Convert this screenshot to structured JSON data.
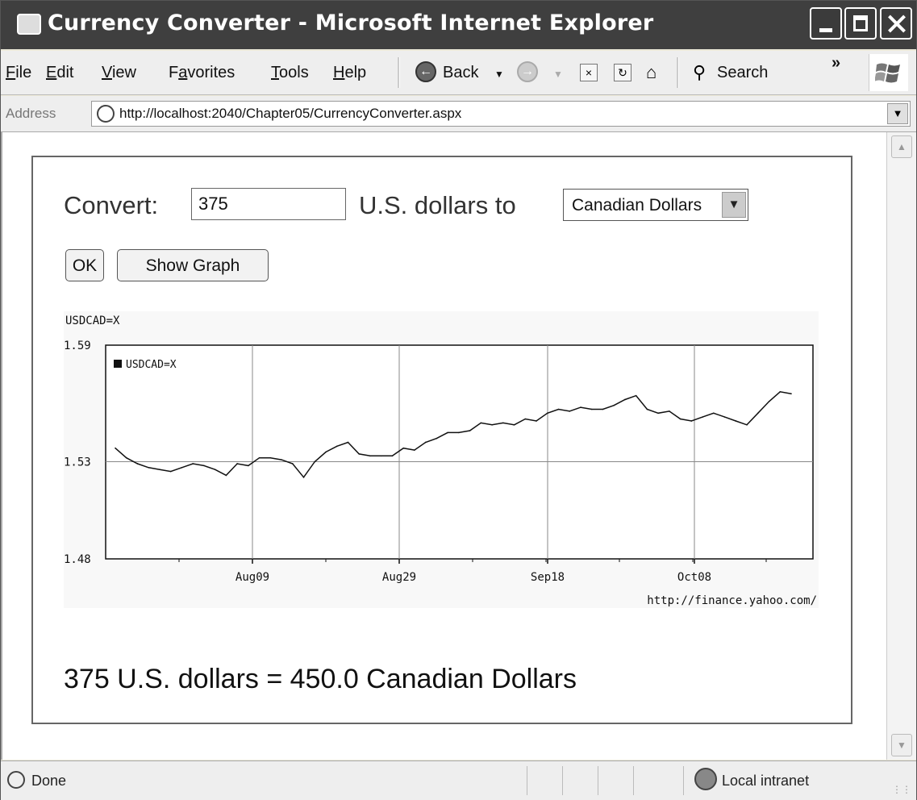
{
  "window": {
    "title": "Currency Converter - Microsoft Internet Explorer"
  },
  "menu": {
    "items": [
      {
        "accel": "F",
        "rest": "ile"
      },
      {
        "accel": "E",
        "rest": "dit"
      },
      {
        "accel": "V",
        "rest": "iew"
      },
      {
        "pre": "F",
        "accel": "a",
        "rest": "vorites"
      },
      {
        "accel": "T",
        "rest": "ools"
      },
      {
        "accel": "H",
        "rest": "elp"
      }
    ]
  },
  "toolbar": {
    "back_label": "Back",
    "search_label": "Search",
    "more": "»"
  },
  "address": {
    "label": "Address",
    "url": "http://localhost:2040/Chapter05/CurrencyConverter.aspx"
  },
  "form": {
    "convert_label": "Convert:",
    "amount_value": "375",
    "usd_label": "U.S. dollars to",
    "currency_selected": "Canadian Dollars",
    "ok_label": "OK",
    "graph_label": "Show Graph"
  },
  "chart_data": {
    "type": "line",
    "title": "USDCAD=X",
    "series": [
      {
        "name": "USDCAD=X",
        "values": [
          1.537,
          1.532,
          1.529,
          1.527,
          1.526,
          1.525,
          1.527,
          1.529,
          1.528,
          1.526,
          1.523,
          1.529,
          1.528,
          1.532,
          1.532,
          1.531,
          1.529,
          1.522,
          1.53,
          1.535,
          1.538,
          1.54,
          1.534,
          1.533,
          1.533,
          1.533,
          1.537,
          1.536,
          1.54,
          1.542,
          1.545,
          1.545,
          1.546,
          1.55,
          1.549,
          1.55,
          1.549,
          1.552,
          1.551,
          1.555,
          1.557,
          1.556,
          1.558,
          1.557,
          1.557,
          1.559,
          1.562,
          1.564,
          1.557,
          1.555,
          1.556,
          1.552,
          1.551,
          1.553,
          1.555,
          1.553,
          1.551,
          1.549,
          1.555,
          1.561,
          1.566,
          1.565
        ]
      }
    ],
    "ylim": [
      1.48,
      1.59
    ],
    "yticks": [
      "1.59",
      "1.53",
      "1.48"
    ],
    "xticks": [
      "Aug09",
      "Aug29",
      "Sep18",
      "Oct08"
    ],
    "legend_position": "top-left",
    "grid": true,
    "source": "http://finance.yahoo.com/"
  },
  "result": {
    "text": "375 U.S. dollars = 450.0 Canadian Dollars"
  },
  "status": {
    "text": "Done",
    "zone": "Local intranet"
  }
}
